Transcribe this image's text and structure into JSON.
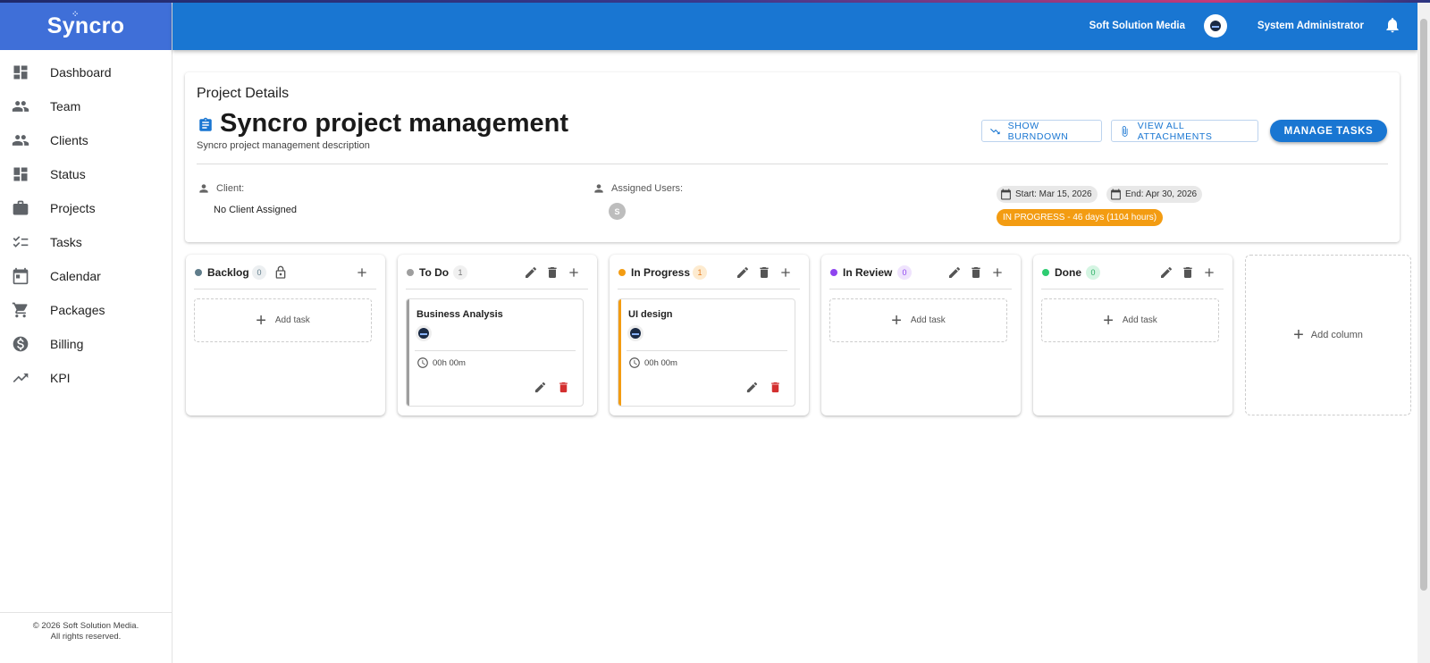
{
  "app": {
    "logo": "Syncro",
    "company": "Soft Solution Media",
    "user_name": "System Administrator"
  },
  "sidebar": {
    "items": [
      {
        "label": "Dashboard",
        "icon": "dashboard-icon"
      },
      {
        "label": "Team",
        "icon": "people-icon"
      },
      {
        "label": "Clients",
        "icon": "people-icon"
      },
      {
        "label": "Status",
        "icon": "dashboard-icon"
      },
      {
        "label": "Projects",
        "icon": "briefcase-icon"
      },
      {
        "label": "Tasks",
        "icon": "checklist-icon"
      },
      {
        "label": "Calendar",
        "icon": "calendar-icon"
      },
      {
        "label": "Packages",
        "icon": "cart-icon"
      },
      {
        "label": "Billing",
        "icon": "dollar-icon"
      },
      {
        "label": "KPI",
        "icon": "trending-up-icon"
      }
    ],
    "footer_line1": "© 2026 Soft Solution Media.",
    "footer_line2": "All rights reserved."
  },
  "project": {
    "section_title": "Project Details",
    "name": "Syncro project management",
    "description": "Syncro project management description",
    "buttons": {
      "burndown": "SHOW BURNDOWN",
      "attachments": "VIEW ALL ATTACHMENTS",
      "manage": "MANAGE TASKS"
    },
    "client_label": "Client:",
    "client_value": "No Client Assigned",
    "users_label": "Assigned Users:",
    "user_initial": "S",
    "start": "Start: Mar 15, 2026",
    "end": "End: Apr 30, 2026",
    "status": "IN PROGRESS - 46 days (1104 hours)",
    "status_color": "#f39c12"
  },
  "board": {
    "add_task_label": "Add task",
    "add_column_label": "Add column",
    "columns": [
      {
        "name": "Backlog",
        "count": "0",
        "color": "#607d8b"
      },
      {
        "name": "To Do",
        "count": "1",
        "color": "#9e9e9e"
      },
      {
        "name": "In Progress",
        "count": "1",
        "color": "#f39c12"
      },
      {
        "name": "In Review",
        "count": "0",
        "color": "#8e44ef"
      },
      {
        "name": "Done",
        "count": "0",
        "color": "#2ecc71"
      }
    ],
    "tasks": [
      {
        "column": "To Do",
        "title": "Business Analysis",
        "time": "00h 00m"
      },
      {
        "column": "In Progress",
        "title": "UI design",
        "time": "00h 00m"
      }
    ]
  }
}
